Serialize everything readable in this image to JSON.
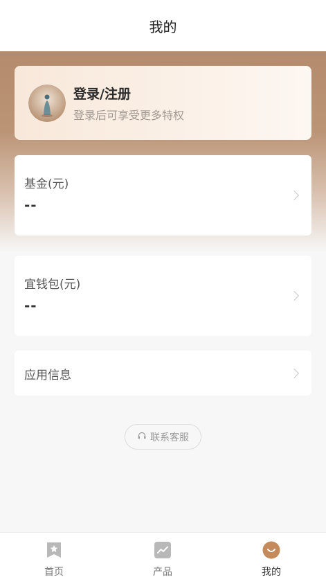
{
  "header": {
    "title": "我的"
  },
  "login": {
    "title": "登录/注册",
    "subtitle": "登录后可享受更多特权"
  },
  "cards": [
    {
      "label": "基金(元)",
      "value": "--"
    },
    {
      "label": "宜钱包(元)",
      "value": "--"
    },
    {
      "label": "应用信息"
    }
  ],
  "service": {
    "label": "联系客服"
  },
  "tabs": [
    {
      "label": "首页",
      "icon": "star-icon"
    },
    {
      "label": "产品",
      "icon": "chart-icon"
    },
    {
      "label": "我的",
      "icon": "smile-icon",
      "active": true
    }
  ],
  "colors": {
    "accent": "#c58a5b",
    "hero": "#b48b6c"
  }
}
